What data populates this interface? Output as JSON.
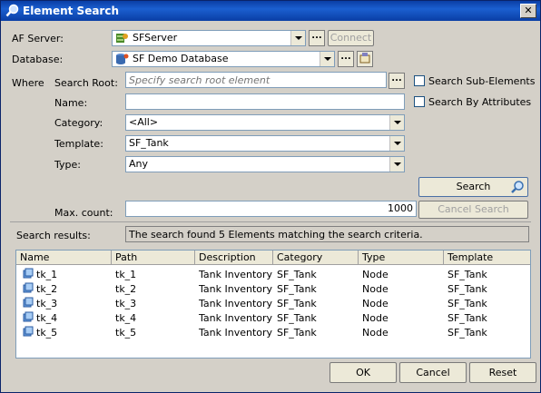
{
  "window": {
    "title": "Element Search"
  },
  "af_server": {
    "label": "AF Server:",
    "value": "SFServer",
    "connect_label": "Connect"
  },
  "database": {
    "label": "Database:",
    "value": "SF Demo Database"
  },
  "where": {
    "label": "Where",
    "search_root_label": "Search Root:",
    "search_root_placeholder": "Specify search root element",
    "name_label": "Name:",
    "name_value": "",
    "category_label": "Category:",
    "category_value": "<All>",
    "template_label": "Template:",
    "template_value": "SF_Tank",
    "type_label": "Type:",
    "type_value": "Any"
  },
  "options": {
    "search_sub_elements": "Search Sub-Elements",
    "search_by_attributes": "Search By Attributes"
  },
  "buttons": {
    "ellipsis": "...",
    "search": "Search",
    "cancel_search": "Cancel Search",
    "ok": "OK",
    "cancel": "Cancel",
    "reset": "Reset"
  },
  "max_count": {
    "label": "Max. count:",
    "value": "1000"
  },
  "results": {
    "label": "Search results:",
    "status": "The search found 5 Elements matching the search criteria.",
    "columns": [
      "Name",
      "Path",
      "Description",
      "Category",
      "Type",
      "Template"
    ],
    "rows": [
      [
        "tk_1",
        "tk_1",
        "Tank Inventory",
        "SF_Tank",
        "Node",
        "SF_Tank"
      ],
      [
        "tk_2",
        "tk_2",
        "Tank Inventory",
        "SF_Tank",
        "Node",
        "SF_Tank"
      ],
      [
        "tk_3",
        "tk_3",
        "Tank Inventory",
        "SF_Tank",
        "Node",
        "SF_Tank"
      ],
      [
        "tk_4",
        "tk_4",
        "Tank Inventory",
        "SF_Tank",
        "Node",
        "SF_Tank"
      ],
      [
        "tk_5",
        "tk_5",
        "Tank Inventory",
        "SF_Tank",
        "Node",
        "SF_Tank"
      ]
    ]
  }
}
